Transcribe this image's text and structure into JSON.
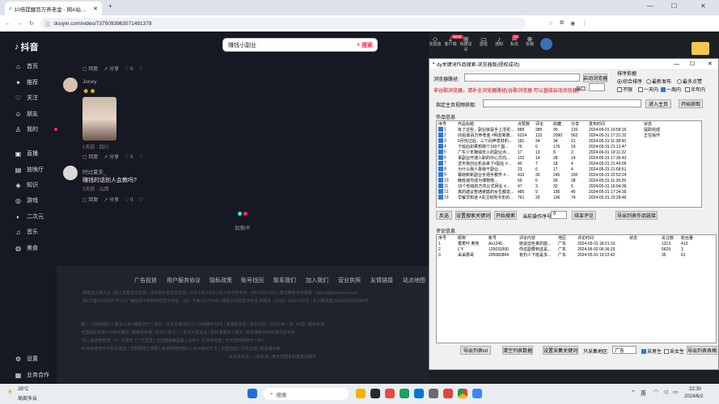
{
  "browser": {
    "tab_title": "10倍提醒百万养老金 - 网A站接播",
    "url": "douyin.com/video/7375093963071491379",
    "icons": [
      "back-icon",
      "forward-icon",
      "reload-icon",
      "info-icon"
    ]
  },
  "douyin": {
    "logo": "抖音",
    "search_value": "赚钱小副业",
    "search_button": "搜索",
    "top_icons": [
      {
        "label": "充钻值",
        "icon": "diamond-icon"
      },
      {
        "label": "客户端",
        "icon": "download-icon"
      },
      {
        "label": "快捷访问",
        "icon": "shortcut-icon",
        "badge": "NEW"
      },
      {
        "label": "壁纸",
        "icon": "wallpaper-icon"
      },
      {
        "label": "通知",
        "icon": "bell-icon"
      },
      {
        "label": "私信",
        "icon": "message-icon",
        "badge": "14"
      },
      {
        "label": "投稿",
        "icon": "upload-icon"
      }
    ],
    "sidebar": [
      {
        "label": "首页",
        "icon": "home-icon"
      },
      {
        "label": "推荐",
        "icon": "recommend-icon"
      },
      {
        "label": "关注",
        "icon": "follow-icon"
      },
      {
        "label": "朋友",
        "icon": "friends-icon"
      },
      {
        "label": "我的",
        "icon": "profile-icon"
      },
      {
        "label": "直播",
        "icon": "live-icon"
      },
      {
        "label": "放映厅",
        "icon": "cinema-icon"
      },
      {
        "label": "知识",
        "icon": "knowledge-icon"
      },
      {
        "label": "游戏",
        "icon": "game-icon"
      },
      {
        "label": "二次元",
        "icon": "anime-icon"
      },
      {
        "label": "音乐",
        "icon": "music-icon"
      },
      {
        "label": "美食",
        "icon": "food-icon"
      }
    ],
    "sidebar_bottom": [
      {
        "label": "设置",
        "icon": "settings-icon"
      },
      {
        "label": "业务合作",
        "icon": "business-icon"
      }
    ],
    "comments": {
      "actions": {
        "reply": "回复",
        "share": "分享",
        "like": "0"
      },
      "c1_user": "Joney",
      "c1_meta": "1天前 · 四川",
      "c2_user": "时过夏末_",
      "c2_text": "赚钱的话别人会教吗?",
      "c2_meta": "2天前 · 山西"
    },
    "loading": "加载中",
    "footer_links": [
      "广告投放",
      "用户服务协议",
      "隐私政策",
      "账号找回",
      "联系我们",
      "加入我们",
      "营业执照",
      "友情链接",
      "站点地图"
    ],
    "footer_lines": [
      "网络谣言曝光台 | 网上有害信息举报 | 违法和不良信息举报：400-140-2108 | 青少年守护专线：400-9922-556 | 算法推荐专项举报：jubao@bytedance.com",
      "京ICP备16016397号-3 | 广播电视节目制作经营许可证 （京）字第20177048 | 网络文化经营许可证 京网文（2022）0838-030号 | 京公网安备11000002002046号",
      "推广 | #抹掉便打人教多么易 #春暖花开 | 地址：北京市海淀区北三环西路甲18号 | 新疆服务业 | 寄业动态 | 共享外卖 | 澳门中国 | 春秋旅游",
      "全国最新高速 | 中西线拥网 | 峰峰信用通 | 新月三星江 | 厂家日大型货运 | 杭州澳展有人服务 | 新加坡新世纪中港货运专线",
      "\"拍儿和家物管家\" 六一兄弟乐了 | 千里里 | 主流健康美图集 | 大中小 2YSH0全能 | 天天增特数新开 | ISO",
      "v8 传道老家乡中网车国店 | 吃剧网络方便剧 | 来到拜佬的西川 | 杭州有的万平 | 全国动画仁同专业前 | 新星推出新",
      "采采采标品 | 人民有道 | 某天的国系科技集团都有"
    ]
  },
  "tool": {
    "window_title": "dy关键词作品搜索-浏览器版(授权成功)",
    "browser_path_label": "浏览器路径:",
    "start_browser": "启动浏览器",
    "hint": "非谷歌浏览器，请补全浏览器路径(谷歌浏览器 可以直接启动浏览器)",
    "port_label": "端口:",
    "sort_label": "排序依据",
    "sort_options": [
      {
        "label": "综合排序",
        "selected": true
      },
      {
        "label": "最新发布",
        "selected": false
      },
      {
        "label": "最多点赞",
        "selected": false
      }
    ],
    "time_options": [
      {
        "label": "不限",
        "checked": false
      },
      {
        "label": "一天内",
        "checked": false
      },
      {
        "label": "一周内",
        "checked": true
      },
      {
        "label": "半年内",
        "checked": false
      }
    ],
    "homepage_label": "指定主页视频获取:",
    "enter_homepage": "进入主页",
    "start_fetch": "开始获取",
    "works_title": "作品信息",
    "works_cols": [
      "序号",
      "作品标题",
      "点赞数",
      "评论",
      "收藏",
      "分享",
      "发布时间",
      "状态"
    ],
    "works_rows": [
      [
        "1",
        "有了这些，副业就是手上活花...",
        "889",
        "285",
        "95",
        "120",
        "2024-06-01 10:58:16",
        "提取完成"
      ],
      [
        "2",
        "00后靠百万养老金 #网友新数...",
        "6224",
        "122",
        "2090",
        "562",
        "2024-05-31 17:31:32",
        "正在操作"
      ],
      [
        "3",
        "6月份过后，三个闷声发财的...",
        "181",
        "34",
        "34",
        "21",
        "2024-05-31 11:38:50",
        ""
      ],
      [
        "4",
        "下班后如果想搞个100个副...",
        "76",
        "0",
        "176",
        "19",
        "2024-05-31 21:12:47",
        ""
      ],
      [
        "5",
        "广东少年赚钱年入的副业点...",
        "17",
        "13",
        "8",
        "3",
        "2024-06-01 19:11:22",
        ""
      ],
      [
        "6",
        "事副业开通入职的中心方向...",
        "102",
        "14",
        "28",
        "14",
        "2024-05-31 17:36:43",
        ""
      ],
      [
        "7",
        "逆天我创业机会来了#副业 #...",
        "40",
        "7",
        "18",
        "4",
        "2024-05-31 21:40:09",
        ""
      ],
      [
        "8",
        "为什么我人靠我干副业...",
        "23",
        "6",
        "17",
        "4",
        "2024-05-31 21:58:51",
        ""
      ],
      [
        "9",
        "幕晓新新副业手把手教学 #...",
        "410",
        "30",
        "245",
        "150",
        "2024-05-31 22:53:24",
        ""
      ],
      [
        "10",
        "晚班城市成为博物馆...",
        "59",
        "6",
        "26",
        "28",
        "2024-05-31 11:36:29",
        ""
      ],
      [
        "11",
        "15个低钱的万花公式网业 #...",
        "47",
        "3",
        "32",
        "5",
        "2024-05-31 16:04:39",
        ""
      ],
      [
        "12",
        "真的建议普通家庭的女生都去...",
        "485",
        "9",
        "195",
        "45",
        "2024-05-31 17:34:35",
        ""
      ],
      [
        "13",
        "早餐早知道 #关注有购今年的...",
        "761",
        "29",
        "196",
        "74",
        "2024-05-31 23:28:46",
        ""
      ]
    ],
    "select_button": "反选",
    "set_keyword_button": "设置搜索关键词",
    "start_search_button": "开始搜索",
    "current_label": "当前操作序号:",
    "current_value": "0",
    "end_comments": "结束评论",
    "export_works": "导出列表作品链接",
    "comments_title": "评论信息",
    "comment_cols": [
      "序号",
      "昵称",
      "账号",
      "评论内容",
      "地区",
      "评论时间",
      "状态",
      "关注数",
      "粉丝量"
    ],
    "comment_rows": [
      [
        "1",
        "香蕉叶 奥地",
        "Ax1245..",
        "她说这些真的能...",
        "广东",
        "2024-05-31 18:21:10",
        "",
        "1313",
        "413"
      ],
      [
        "2",
        "L'Y",
        "125033300",
        "你这副要到这是...",
        "广东",
        "2024-06-02 06:36:29",
        "",
        "5629",
        "3"
      ],
      [
        "3",
        "采采爵哥",
        "205082864",
        "有钓人下班是多...",
        "广东",
        "2024-05-31 19:22:42",
        "",
        "35",
        "61"
      ]
    ],
    "export_txt": "导出列表txt",
    "clear_comments": "清空列表数据",
    "set_reply_kw": "设置采集关键词",
    "region_label": "只采集地区:",
    "region_value": "广东",
    "collect_male": "采男生",
    "collect_female": "采女生",
    "export_table": "导出列表表格",
    "collect_male_checked": true,
    "collect_female_checked": false
  },
  "taskbar": {
    "weather_temp": "28°C",
    "weather_desc": "局部多云",
    "search_placeholder": "搜索",
    "time": "22:30",
    "date": "2024/6/2",
    "lang": "英"
  }
}
